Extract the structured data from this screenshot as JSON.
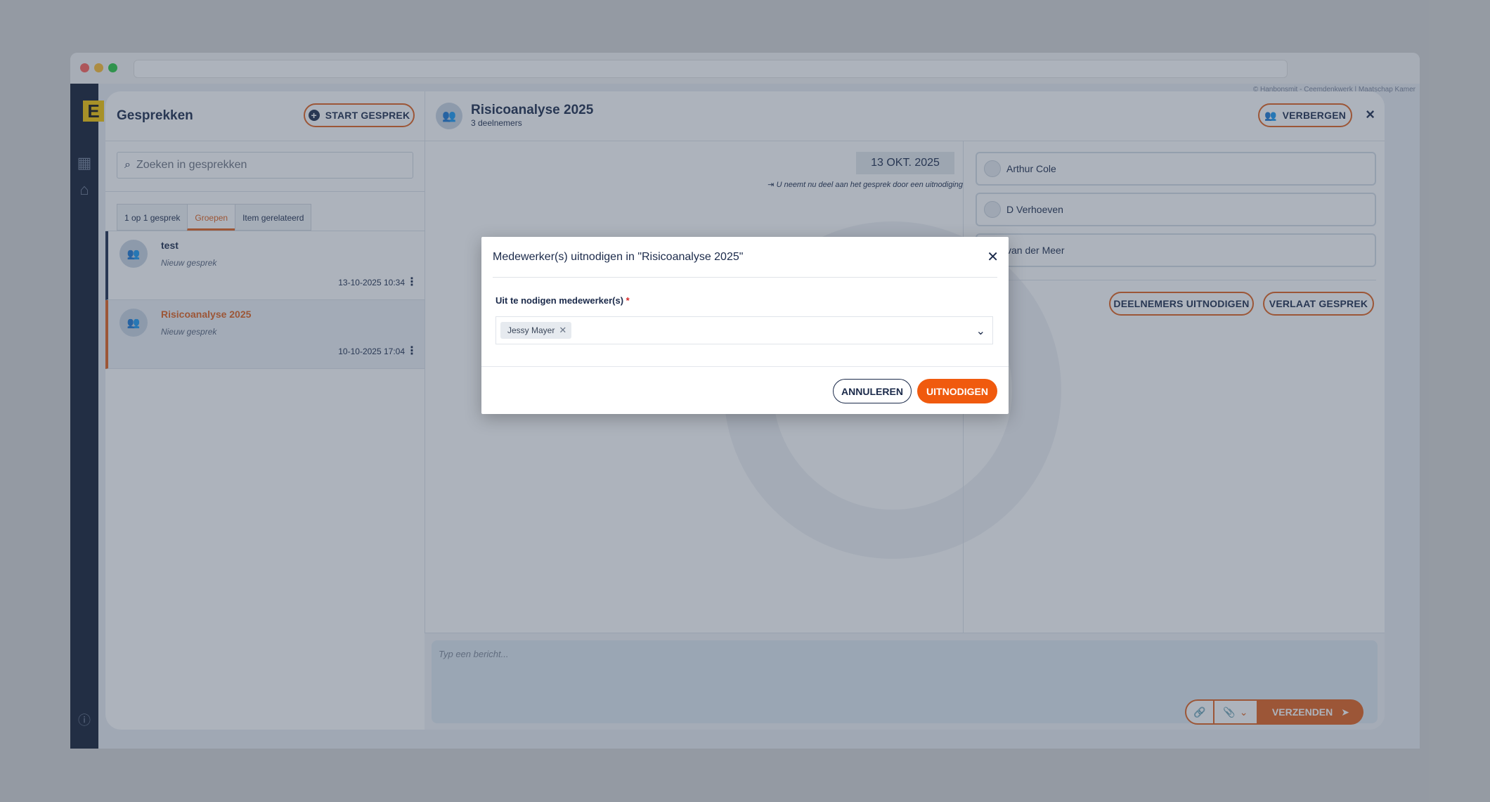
{
  "app": {
    "logo_letter": "E",
    "top_strip_text": "© Hanbonsmit - Ceemdenkwerk | Maatschap Kamer"
  },
  "panel": {
    "title": "Gesprekken",
    "start_button": "START GESPREK",
    "conversation_title": "Risicoanalyse 2025",
    "participant_count": "3 deelnemers",
    "hide_button": "VERBERGEN",
    "search_placeholder": "Zoeken in gesprekken",
    "tabs": [
      {
        "label": "1 op 1 gesprek"
      },
      {
        "label": "Groepen"
      },
      {
        "label": "Item gerelateerd"
      }
    ],
    "conversations": [
      {
        "name": "test",
        "sub": "Nieuw gesprek",
        "time": "13-10-2025 10:34"
      },
      {
        "name": "Risicoanalyse 2025",
        "sub": "Nieuw gesprek",
        "time": "10-10-2025 17:04"
      }
    ],
    "date_chip": "13 OKT. 2025",
    "join_note": "U neemt nu deel aan het gesprek door een uitnodiging",
    "participants": [
      {
        "name": "Arthur Cole"
      },
      {
        "name": "D Verhoeven"
      },
      {
        "name": "van der Meer"
      }
    ],
    "invite_participants_button": "DEELNEMERS UITNODIGEN",
    "leave_button": "VERLAAT GESPREK",
    "composer_placeholder": "Typ een bericht...",
    "send_button": "VERZENDEN"
  },
  "modal": {
    "title": "Medewerker(s) uitnodigen in \"Risicoanalyse 2025\"",
    "field_label": "Uit te nodigen medewerker(s)",
    "required_mark": "*",
    "selected": [
      {
        "label": "Jessy Mayer"
      }
    ],
    "cancel_button": "ANNULEREN",
    "confirm_button": "UITNODIGEN"
  },
  "colors": {
    "accent": "#f05a0e",
    "navy": "#1b2a4a"
  }
}
